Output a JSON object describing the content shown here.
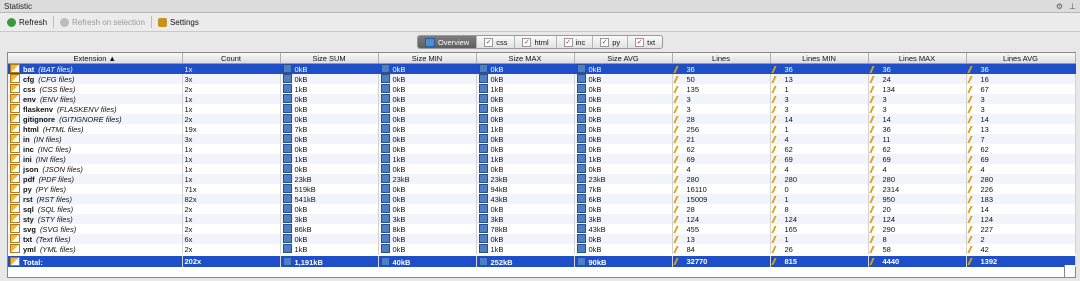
{
  "window": {
    "title": "Statistic"
  },
  "toolbar": {
    "refresh": "Refresh",
    "refresh_selection": "Refresh on selection",
    "settings": "Settings"
  },
  "tabs": [
    "Overview",
    "css",
    "html",
    "inc",
    "py",
    "txt"
  ],
  "columns": [
    "Extension ▲",
    "Count",
    "Size SUM",
    "Size MIN",
    "Size MAX",
    "Size AVG",
    "Lines",
    "Lines MIN",
    "Lines MAX",
    "Lines AVG"
  ],
  "rows": [
    {
      "ext": "bat",
      "desc": "(BAT files)",
      "count": "1x",
      "sum": "0kB",
      "min": "0kB",
      "max": "0kB",
      "avg": "0kB",
      "lines": "36",
      "lmin": "36",
      "lmax": "36",
      "lavg": "36"
    },
    {
      "ext": "cfg",
      "desc": "(CFG files)",
      "count": "3x",
      "sum": "0kB",
      "min": "0kB",
      "max": "0kB",
      "avg": "0kB",
      "lines": "50",
      "lmin": "13",
      "lmax": "24",
      "lavg": "16"
    },
    {
      "ext": "css",
      "desc": "(CSS files)",
      "count": "2x",
      "sum": "1kB",
      "min": "0kB",
      "max": "1kB",
      "avg": "0kB",
      "lines": "135",
      "lmin": "1",
      "lmax": "134",
      "lavg": "67"
    },
    {
      "ext": "env",
      "desc": "(ENV files)",
      "count": "1x",
      "sum": "0kB",
      "min": "0kB",
      "max": "0kB",
      "avg": "0kB",
      "lines": "3",
      "lmin": "3",
      "lmax": "3",
      "lavg": "3"
    },
    {
      "ext": "flaskenv",
      "desc": "(FLASKENV files)",
      "count": "1x",
      "sum": "0kB",
      "min": "0kB",
      "max": "0kB",
      "avg": "0kB",
      "lines": "3",
      "lmin": "3",
      "lmax": "3",
      "lavg": "3"
    },
    {
      "ext": "gitignore",
      "desc": "(GITIGNORE files)",
      "count": "2x",
      "sum": "0kB",
      "min": "0kB",
      "max": "0kB",
      "avg": "0kB",
      "lines": "28",
      "lmin": "14",
      "lmax": "14",
      "lavg": "14"
    },
    {
      "ext": "html",
      "desc": "(HTML files)",
      "count": "19x",
      "sum": "7kB",
      "min": "0kB",
      "max": "1kB",
      "avg": "0kB",
      "lines": "256",
      "lmin": "1",
      "lmax": "36",
      "lavg": "13"
    },
    {
      "ext": "in",
      "desc": "(IN files)",
      "count": "3x",
      "sum": "0kB",
      "min": "0kB",
      "max": "0kB",
      "avg": "0kB",
      "lines": "21",
      "lmin": "4",
      "lmax": "11",
      "lavg": "7"
    },
    {
      "ext": "inc",
      "desc": "(INC files)",
      "count": "1x",
      "sum": "0kB",
      "min": "0kB",
      "max": "0kB",
      "avg": "0kB",
      "lines": "62",
      "lmin": "62",
      "lmax": "62",
      "lavg": "62"
    },
    {
      "ext": "ini",
      "desc": "(INI files)",
      "count": "1x",
      "sum": "1kB",
      "min": "1kB",
      "max": "1kB",
      "avg": "1kB",
      "lines": "69",
      "lmin": "69",
      "lmax": "69",
      "lavg": "69"
    },
    {
      "ext": "json",
      "desc": "(JSON files)",
      "count": "1x",
      "sum": "0kB",
      "min": "0kB",
      "max": "0kB",
      "avg": "0kB",
      "lines": "4",
      "lmin": "4",
      "lmax": "4",
      "lavg": "4"
    },
    {
      "ext": "pdf",
      "desc": "(PDF files)",
      "count": "1x",
      "sum": "23kB",
      "min": "23kB",
      "max": "23kB",
      "avg": "23kB",
      "lines": "280",
      "lmin": "280",
      "lmax": "280",
      "lavg": "280"
    },
    {
      "ext": "py",
      "desc": "(PY files)",
      "count": "71x",
      "sum": "519kB",
      "min": "0kB",
      "max": "94kB",
      "avg": "7kB",
      "lines": "16110",
      "lmin": "0",
      "lmax": "2314",
      "lavg": "226"
    },
    {
      "ext": "rst",
      "desc": "(RST files)",
      "count": "82x",
      "sum": "541kB",
      "min": "0kB",
      "max": "43kB",
      "avg": "6kB",
      "lines": "15009",
      "lmin": "1",
      "lmax": "950",
      "lavg": "183"
    },
    {
      "ext": "sql",
      "desc": "(SQL files)",
      "count": "2x",
      "sum": "0kB",
      "min": "0kB",
      "max": "0kB",
      "avg": "0kB",
      "lines": "28",
      "lmin": "8",
      "lmax": "20",
      "lavg": "14"
    },
    {
      "ext": "sty",
      "desc": "(STY files)",
      "count": "1x",
      "sum": "3kB",
      "min": "3kB",
      "max": "3kB",
      "avg": "3kB",
      "lines": "124",
      "lmin": "124",
      "lmax": "124",
      "lavg": "124"
    },
    {
      "ext": "svg",
      "desc": "(SVG files)",
      "count": "2x",
      "sum": "86kB",
      "min": "8kB",
      "max": "78kB",
      "avg": "43kB",
      "lines": "455",
      "lmin": "165",
      "lmax": "290",
      "lavg": "227"
    },
    {
      "ext": "txt",
      "desc": "(Text files)",
      "count": "6x",
      "sum": "0kB",
      "min": "0kB",
      "max": "0kB",
      "avg": "0kB",
      "lines": "13",
      "lmin": "1",
      "lmax": "8",
      "lavg": "2"
    },
    {
      "ext": "yml",
      "desc": "(YML files)",
      "count": "2x",
      "sum": "1kB",
      "min": "0kB",
      "max": "1kB",
      "avg": "0kB",
      "lines": "84",
      "lmin": "26",
      "lmax": "58",
      "lavg": "42"
    }
  ],
  "total": {
    "label": "Total:",
    "count": "202x",
    "sum": "1,191kB",
    "min": "40kB",
    "max": "252kB",
    "avg": "90kB",
    "lines": "32770",
    "lmin": "815",
    "lmax": "4440",
    "lavg": "1392"
  },
  "colors": {
    "selection": "#1f4fc8",
    "accent": "#4f7fc3"
  }
}
